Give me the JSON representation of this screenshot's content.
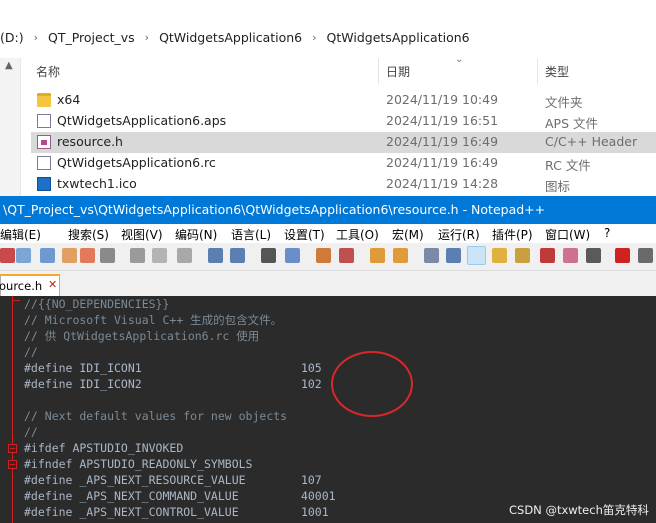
{
  "explorer": {
    "breadcrumb": [
      "(D:)",
      "QT_Project_vs",
      "QtWidgetsApplication6",
      "QtWidgetsApplication6"
    ],
    "columns": {
      "name": "名称",
      "date": "日期",
      "type": "类型"
    },
    "files": [
      {
        "name": "x64",
        "date": "2024/11/19 10:49",
        "type": "文件夹",
        "icon": "folder-icon"
      },
      {
        "name": "QtWidgetsApplication6.aps",
        "date": "2024/11/19 16:51",
        "type": "APS 文件",
        "icon": "file-icon"
      },
      {
        "name": "resource.h",
        "date": "2024/11/19 16:49",
        "type": "C/C++ Header",
        "icon": "header-file-icon"
      },
      {
        "name": "QtWidgetsApplication6.rc",
        "date": "2024/11/19 16:49",
        "type": "RC 文件",
        "icon": "rc-file-icon"
      },
      {
        "name": "txwtech1.ico",
        "date": "2024/11/19 14:28",
        "type": "图标",
        "icon": "ico-file-icon"
      }
    ],
    "selected_index": 2
  },
  "notepad": {
    "title": "\\QT_Project_vs\\QtWidgetsApplication6\\QtWidgetsApplication6\\resource.h - Notepad++",
    "menu": [
      "编辑(E)",
      "搜索(S)",
      "视图(V)",
      "编码(N)",
      "语言(L)",
      "设置(T)",
      "工具(O)",
      "宏(M)",
      "运行(R)",
      "插件(P)",
      "窗口(W)",
      "?"
    ],
    "tab_label": "ource.h",
    "code_lines": [
      "//{{NO_DEPENDENCIES}}",
      "// Microsoft Visual C++ 生成的包含文件。",
      "// 供 QtWidgetsApplication6.rc 使用",
      "//",
      "#define IDI_ICON1                       105",
      "#define IDI_ICON2                       102",
      "",
      "// Next default values for new objects",
      "//",
      "#ifdef APSTUDIO_INVOKED",
      "#ifndef APSTUDIO_READONLY_SYMBOLS",
      "#define _APS_NEXT_RESOURCE_VALUE        107",
      "#define _APS_NEXT_COMMAND_VALUE         40001",
      "#define _APS_NEXT_CONTROL_VALUE         1001"
    ]
  },
  "watermark": "CSDN @txwtech笛克特科",
  "colors": {
    "titlebar": "#0078d7",
    "editor_bg": "#2b2b2b",
    "annotation": "#d8282a"
  }
}
